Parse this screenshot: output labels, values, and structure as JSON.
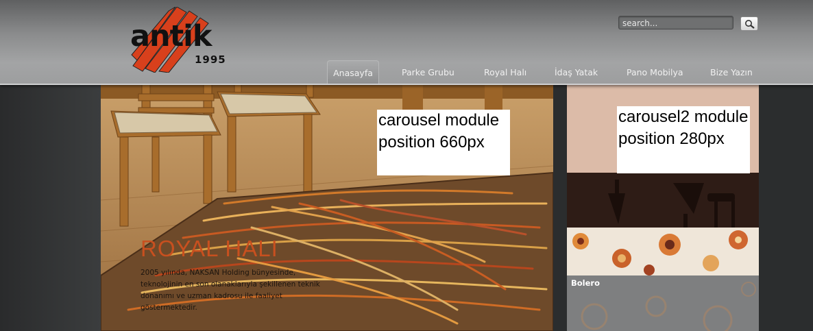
{
  "logo": {
    "word": "antik",
    "year": "1995"
  },
  "search": {
    "placeholder": "search..."
  },
  "nav": {
    "items": [
      {
        "label": "Anasayfa",
        "active": true
      },
      {
        "label": "Parke Grubu"
      },
      {
        "label": "Royal Halı"
      },
      {
        "label": "İdaş Yatak"
      },
      {
        "label": "Pano Mobilya"
      },
      {
        "label": "Bize Yazın"
      }
    ]
  },
  "carousel": {
    "placeholder_label": "carousel module position 660px",
    "slide_title": "ROYAL HALI",
    "slide_text": "2005 yılında, NAKSAN Holding bünyesinde, teknolojinin en son olanaklarıyla şekillenen teknik donanımı ve uzman kadrosu ile faaliyet göstermektedir."
  },
  "carousel2": {
    "placeholder_label": "carousel2 module position 280px",
    "caption": "Bolero"
  },
  "colors": {
    "accent_title": "#c8501f",
    "logo_red": "#d8401c"
  }
}
